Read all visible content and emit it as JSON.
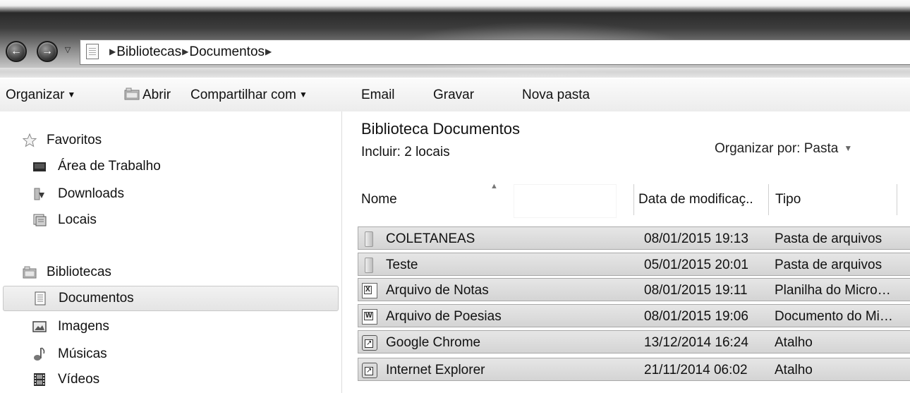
{
  "address": {
    "back_icon": "←",
    "forward_icon": "→",
    "recent_icon": "▽",
    "crumbs": [
      "Bibliotecas",
      "Documentos"
    ]
  },
  "toolbar": {
    "organizar": "Organizar",
    "abrir": "Abrir",
    "compartilhar": "Compartilhar com",
    "email": "Email",
    "gravar": "Gravar",
    "nova_pasta": "Nova pasta"
  },
  "nav": {
    "favoritos": "Favoritos",
    "area_trabalho": "Área de Trabalho",
    "downloads": "Downloads",
    "locais": "Locais",
    "bibliotecas": "Bibliotecas",
    "documentos": "Documentos",
    "imagens": "Imagens",
    "musicas": "Músicas",
    "videos": "Vídeos"
  },
  "library": {
    "title": "Biblioteca Documentos",
    "include": "Incluir: 2 locais",
    "arrange_by": "Organizar por: Pasta"
  },
  "columns": {
    "name": "Nome",
    "date": "Data de modificaç..",
    "type": "Tipo"
  },
  "files": [
    {
      "name": "COLETANEAS",
      "date": "08/01/2015 19:13",
      "type": "Pasta de arquivos",
      "icon": "folder-icon"
    },
    {
      "name": "Teste",
      "date": "05/01/2015 20:01",
      "type": "Pasta de arquivos",
      "icon": "folder-icon"
    },
    {
      "name": "Arquivo de Notas",
      "date": "08/01/2015 19:11",
      "type": "Planilha do Micro…",
      "icon": "excel-icon"
    },
    {
      "name": "Arquivo de Poesias",
      "date": "08/01/2015 19:06",
      "type": "Documento do Mi…",
      "icon": "word-icon"
    },
    {
      "name": "Google Chrome",
      "date": "13/12/2014 16:24",
      "type": "Atalho",
      "icon": "shortcut-icon"
    },
    {
      "name": "Internet Explorer",
      "date": "21/11/2014 06:02",
      "type": "Atalho",
      "icon": "shortcut-icon"
    }
  ]
}
